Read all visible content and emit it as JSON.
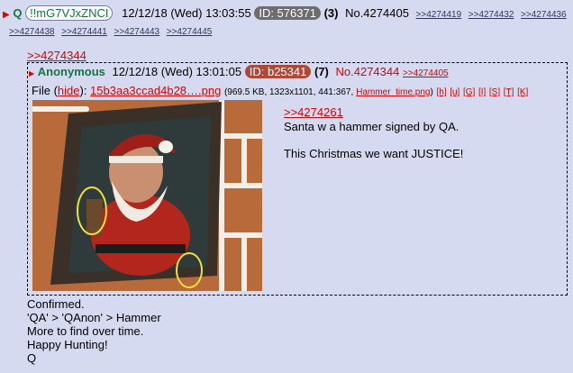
{
  "post": {
    "q_prefix": "Q",
    "tripcode": "!!mG7VJxZNCI",
    "datetime": "12/12/18 (Wed) 13:03:55",
    "id_label": "ID: 576371",
    "id_color": "#6d6d6d",
    "count": "(3)",
    "number": "No.4274405",
    "backlinks": [
      ">>4274419",
      ">>4274432",
      ">>4274436",
      ">>4274438",
      ">>4274441",
      ">>4274443",
      ">>4274445"
    ],
    "reply_ref": ">>4274344",
    "body_lines": [
      "Confirmed.",
      "'QA' > 'QAnon' > Hammer",
      "More to find over time.",
      "Happy Hunting!",
      "Q"
    ]
  },
  "quoted": {
    "name": "Anonymous",
    "datetime": "12/12/18 (Wed) 13:01:05",
    "id_label": "ID: b25341",
    "id_color": "#b0483a",
    "count": "(7)",
    "number": "No.4274344",
    "backlink": ">>4274405",
    "file_label": "File",
    "hide_text": "hide",
    "file_name": "15b3aa3ccad4b28….png",
    "file_meta": "(969.5 KB, 1323x1101, 441:367,",
    "file_orig": "Hammer_time.png",
    "file_links": [
      "[h]",
      "[u]",
      "[G]",
      "[I]",
      "[S]",
      "[T]",
      "[K]"
    ],
    "reply_ref": ">>4274261",
    "text_lines": [
      "Santa w a hammer signed by QA.",
      "",
      "This Christmas we want JUSTICE!"
    ],
    "image_icon": "santa-painting-image"
  }
}
